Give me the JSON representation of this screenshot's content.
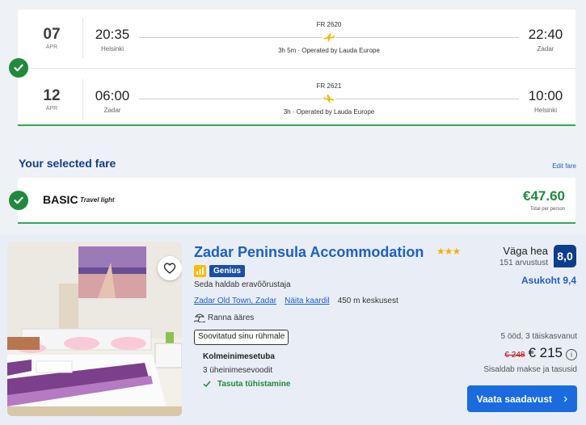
{
  "flights": [
    {
      "day": "07",
      "month": "APR",
      "dep_time": "20:35",
      "dep_city": "Helsinki",
      "flight_no": "FR 2620",
      "duration": "3h 5m · Operated by Lauda Europe",
      "arr_time": "22:40",
      "arr_city": "Zadar"
    },
    {
      "day": "12",
      "month": "APR",
      "dep_time": "06:00",
      "dep_city": "Zadar",
      "flight_no": "FR 2621",
      "duration": "3h · Operated by Lauda Europe",
      "arr_time": "10:00",
      "arr_city": "Helsinki"
    }
  ],
  "fare": {
    "section_title": "Your selected fare",
    "edit_label": "Edit fare",
    "name": "BASIC",
    "subtitle": "Travel light",
    "price": "€47.60",
    "price_note": "Total per person"
  },
  "hotel": {
    "name": "Zadar Peninsula Accommodation",
    "stars": "★★★",
    "genius": "Genius",
    "managed_by": "Seda haldab eravõõrustaja",
    "location_link": "Zadar Old Town, Zadar",
    "map_link": "Näita kaardil",
    "distance": "450 m keskusest",
    "beach": "Ranna ääres",
    "recommended": "Soovitatud sinu rühmale",
    "room_name": "Kolmeinimesetuba",
    "beds": "3 üheinimesevoodit",
    "free_cancel": "Tasuta tühistamine",
    "rating_word": "Väga hea",
    "reviews": "151 arvustust",
    "score": "8,0",
    "location_score": "Asukoht 9,4",
    "stay": "5 ööd, 3 täiskasvanut",
    "old_price": "€ 248",
    "new_price": "€ 215",
    "info": "i",
    "taxes": "Sisaldab makse ja tasusid",
    "cta": "Vaata saadavust",
    "cta_arrow": "›"
  },
  "colors": {
    "accent_blue": "#1a6be0",
    "title_blue": "#143d8c",
    "success_green": "#1f8a3c",
    "score_navy": "#0b3e8c",
    "star_yellow": "#f5b301"
  },
  "icons": [
    "check-icon",
    "plane-icon",
    "heart-icon",
    "genius-icon",
    "beach-icon",
    "checkmark-icon",
    "info-icon",
    "chevron-right-icon"
  ]
}
